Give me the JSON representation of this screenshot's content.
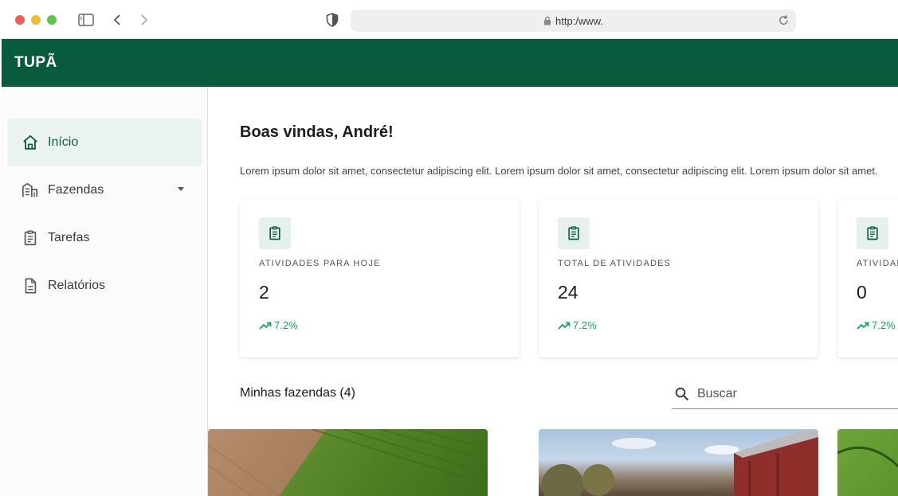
{
  "browser": {
    "url": "http:/www."
  },
  "header": {
    "brand": "TUPÃ"
  },
  "sidebar": {
    "items": [
      {
        "label": "Início",
        "icon": "home-icon",
        "active": true
      },
      {
        "label": "Fazendas",
        "icon": "farm-building-icon",
        "has_dropdown": true
      },
      {
        "label": "Tarefas",
        "icon": "clipboard-icon"
      },
      {
        "label": "Relatórios",
        "icon": "document-icon"
      }
    ]
  },
  "main": {
    "welcome": "Boas vindas, André!",
    "description": "Lorem ipsum dolor sit amet, consectetur adipiscing elit. Lorem ipsum dolor sit amet, consectetur adipiscing elit. Lorem ipsum dolor sit amet.",
    "cards": [
      {
        "label": "ATIVIDADES PARA HOJE",
        "value": "2",
        "trend": "7.2%",
        "icon": "clipboard-icon"
      },
      {
        "label": "TOTAL DE ATIVIDADES",
        "value": "24",
        "trend": "7.2%",
        "icon": "clipboard-icon"
      },
      {
        "label": "ATIVIDADES",
        "value": "0",
        "trend": "7.2%",
        "icon": "clipboard-icon"
      }
    ],
    "farms_title": "Minhas fazendas (4)",
    "search_placeholder": "Buscar"
  },
  "colors": {
    "brand_green": "#085b3d",
    "trend_green": "#12a560",
    "active_bg": "#ebf3ef"
  }
}
